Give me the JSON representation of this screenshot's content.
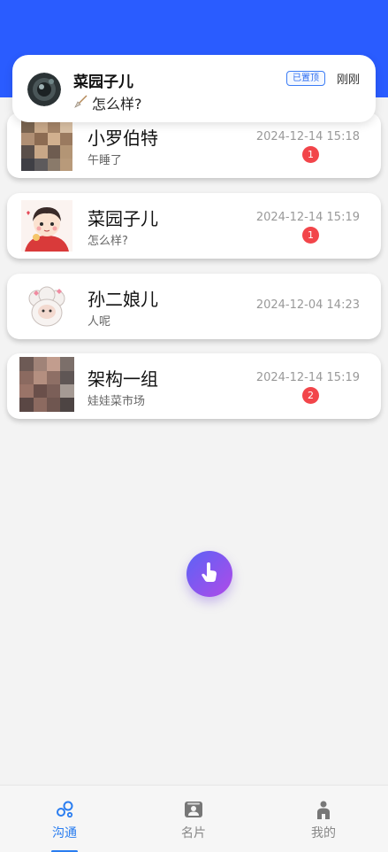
{
  "notification": {
    "sender": "菜园子儿",
    "message": "怎么样?",
    "pinned_label": "已置顶",
    "time": "刚刚"
  },
  "chats": [
    {
      "name": "小罗伯特",
      "preview": "午睡了",
      "time": "2024-12-14 15:18",
      "unread": "1"
    },
    {
      "name": "菜园子儿",
      "preview": "怎么样?",
      "time": "2024-12-14 15:19",
      "unread": "1"
    },
    {
      "name": "孙二娘儿",
      "preview": "人呢",
      "time": "2024-12-04 14:23",
      "unread": ""
    },
    {
      "name": "架构一组",
      "preview": "娃娃菜市场",
      "time": "2024-12-14 15:19",
      "unread": "2"
    }
  ],
  "tabs": [
    {
      "label": "沟通",
      "icon": "chat-bubbles-icon",
      "active": true
    },
    {
      "label": "名片",
      "icon": "contact-card-icon",
      "active": false
    },
    {
      "label": "我的",
      "icon": "person-icon",
      "active": false
    }
  ],
  "colors": {
    "header": "#2a5cff",
    "accent": "#2a7df0",
    "badge": "#f2454a",
    "fab_start": "#5b63f6",
    "fab_end": "#b04ae8"
  },
  "fab_icon": "tap-hand-icon"
}
